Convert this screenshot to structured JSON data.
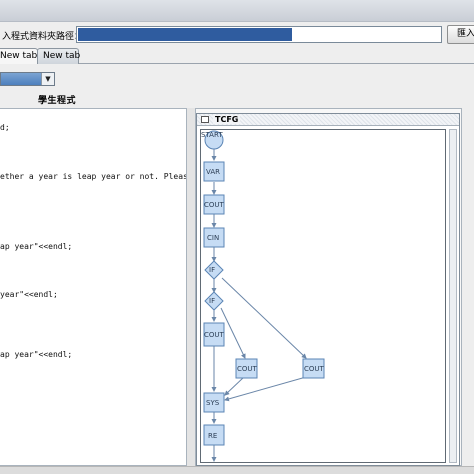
{
  "path_row": {
    "label": "入程式資料夾路徑：",
    "import_button": "匯入"
  },
  "tabs": [
    {
      "label": "New tab"
    },
    {
      "label": "New tab"
    }
  ],
  "student_program_label": "學生程式",
  "code_lines": [
    "d;",
    "ether a year is leap year or not. Please input a year: \"",
    "ap year\"<<endl;",
    "year\"<<endl;",
    "ap year\"<<endl;"
  ],
  "cfg_frame": {
    "title": "TCFG",
    "nodes": [
      "START",
      "VAR",
      "COUT",
      "CIN",
      "IF",
      "IF",
      "COUT",
      "COUT",
      "COUT",
      "SYS",
      "RE"
    ]
  },
  "colors": {
    "node_fill": "#c6dcf4",
    "node_stroke": "#5b85b5",
    "edge": "#6a86a8",
    "selection": "#2f5c9f"
  }
}
